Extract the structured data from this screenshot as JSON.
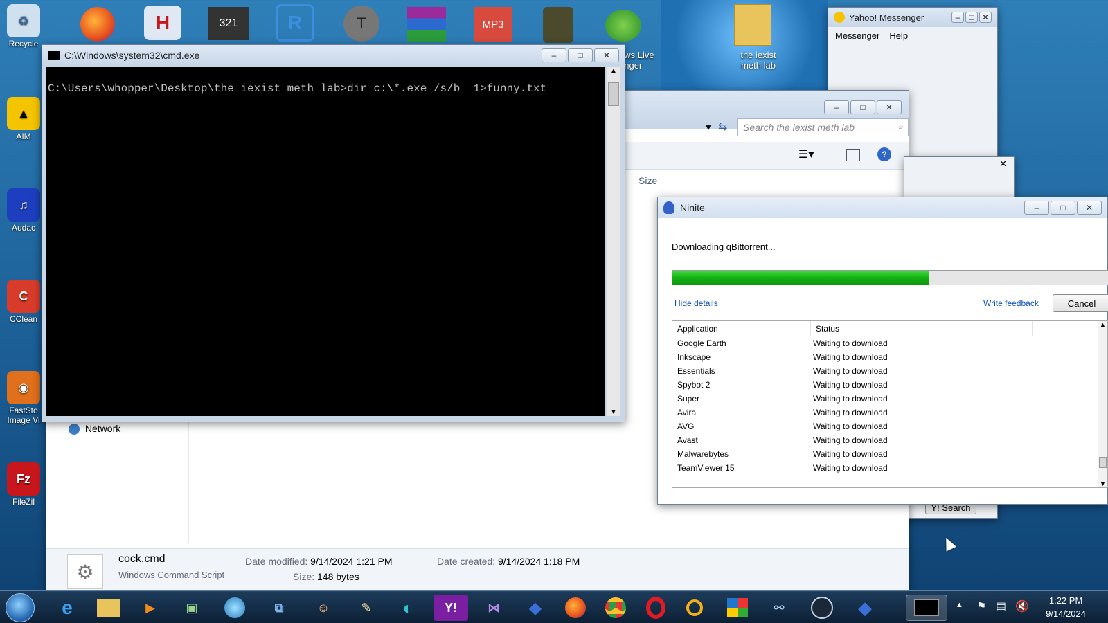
{
  "desktop": {
    "icons": [
      "Recycle",
      "AIM",
      "Audac",
      "CClean",
      "FastSto Image Vi",
      "FileZil"
    ],
    "top_icons_text": {
      "mp3": "MP3",
      "wlm_label": "ows Live enger",
      "folder_label": "the iexist meth lab"
    }
  },
  "cmd": {
    "title": "C:\\Windows\\system32\\cmd.exe",
    "line": "C:\\Users\\whopper\\Desktop\\the iexist meth lab>dir c:\\*.exe /s/b  1>funny.txt"
  },
  "explorer": {
    "search_placeholder": "Search the iexist meth lab",
    "column_size": "Size",
    "nav_network": "Network",
    "detail": {
      "name": "cock.cmd",
      "type": "Windows Command Script",
      "modified_label": "Date modified:",
      "modified": "9/14/2024 1:21 PM",
      "created_label": "Date created:",
      "created": "9/14/2024 1:18 PM",
      "size_label": "Size:",
      "size": "148 bytes"
    }
  },
  "yahoo": {
    "title": "Yahoo! Messenger",
    "menu": [
      "Messenger",
      "Help"
    ],
    "search_btn": "Y! Search"
  },
  "ninite": {
    "title": "Ninite",
    "status": "Downloading qBittorrent...",
    "progress": 0.58,
    "hide_details": "Hide details",
    "write_feedback": "Write feedback",
    "cancel": "Cancel",
    "col_app": "Application",
    "col_status": "Status",
    "rows": [
      {
        "app": "Google Earth",
        "status": "Waiting to download"
      },
      {
        "app": "Inkscape",
        "status": "Waiting to download"
      },
      {
        "app": "Essentials",
        "status": "Waiting to download"
      },
      {
        "app": "Spybot 2",
        "status": "Waiting to download"
      },
      {
        "app": "Super",
        "status": "Waiting to download"
      },
      {
        "app": "Avira",
        "status": "Waiting to download"
      },
      {
        "app": "AVG",
        "status": "Waiting to download"
      },
      {
        "app": "Avast",
        "status": "Waiting to download"
      },
      {
        "app": "Malwarebytes",
        "status": "Waiting to download"
      },
      {
        "app": "TeamViewer 15",
        "status": "Waiting to download"
      }
    ]
  },
  "taskbar": {
    "time": "1:22 PM",
    "date": "9/14/2024",
    "colors": {
      "accent": "#2f7fb9",
      "progress": "#16b016"
    }
  }
}
